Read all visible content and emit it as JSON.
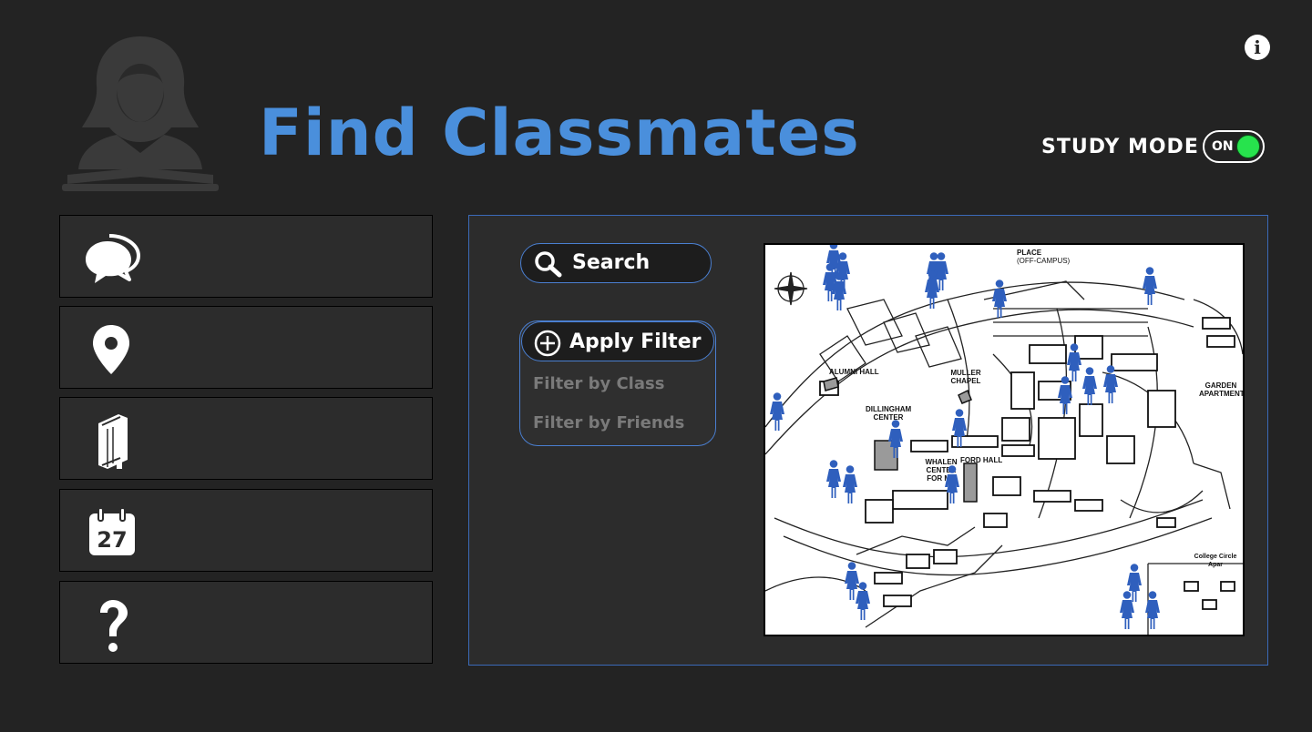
{
  "header": {
    "title": "Find Classmates",
    "study_mode_label": "STUDY MODE",
    "study_mode_toggle": "ON",
    "study_mode_on": true
  },
  "sidebar": {
    "items": [
      {
        "icon": "chat-bubbles-icon"
      },
      {
        "icon": "location-pin-icon"
      },
      {
        "icon": "book-icon"
      },
      {
        "icon": "calendar-icon",
        "calendar_day": "27"
      },
      {
        "icon": "question-mark-icon"
      }
    ]
  },
  "main": {
    "search_label": "Search",
    "apply_filter_label": "Apply Filter",
    "filter_options": [
      "Filter by Class",
      "Filter by Friends"
    ]
  },
  "map": {
    "labels": {
      "place": "PLACE",
      "off_campus": "(OFF-CAMPUS)",
      "alumni_hall": "ALUMNI HALL",
      "muller_chapel": "MULLER CHAPEL",
      "dillingham_center": "DILLINGHAM CENTER",
      "whalen_center": "WHALEN CENTER FOR MU",
      "ford_hall": "FORD HALL",
      "garden_apartments": "GARDEN APARTMENT",
      "college_circle": "College Circle Apar"
    }
  },
  "colors": {
    "accent": "#4a8fdc",
    "background": "#232323",
    "toggle_on": "#27e34d",
    "person_marker": "#2f5fbd"
  }
}
